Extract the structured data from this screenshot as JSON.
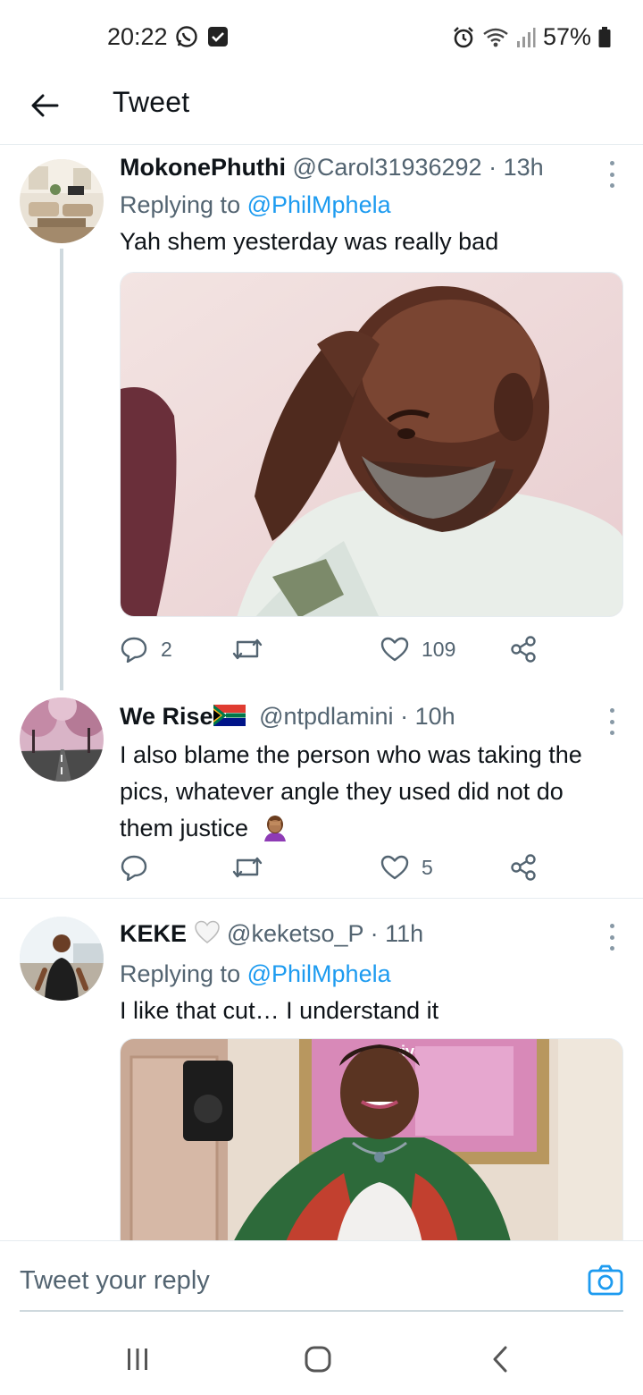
{
  "status_bar": {
    "time": "20:22",
    "battery": "57%"
  },
  "header": {
    "title": "Tweet"
  },
  "tweets": [
    {
      "name": "MokonePhuthi",
      "handle": "@Carol31936292",
      "separator": "·",
      "time": "13h",
      "replying_label": "Replying to",
      "replying_to": "@PhilMphela",
      "text": "Yah shem yesterday was really bad",
      "stats": {
        "replies": "2",
        "retweets": "",
        "likes": "109"
      }
    },
    {
      "name": "We Rise",
      "handle": "@ntpdlamini",
      "separator": "·",
      "time": "10h",
      "text": "I also blame the person who was taking the pics, whatever angle they used did not do them justice",
      "stats": {
        "replies": "",
        "retweets": "",
        "likes": "5"
      }
    },
    {
      "name": "KEKE",
      "handle": "@keketso_P",
      "separator": "·",
      "time": "11h",
      "replying_label": "Replying to",
      "replying_to": "@PhilMphela",
      "text": "I like that cut… I understand it",
      "media_caption": "ewives"
    }
  ],
  "composer": {
    "placeholder": "Tweet your reply"
  },
  "colors": {
    "accent": "#1d9bf0",
    "text": "#0f1419",
    "muted": "#536471"
  },
  "icons": [
    "whatsapp-icon",
    "check-box-icon",
    "alarm-icon",
    "wifi-icon",
    "signal-icon",
    "battery-icon",
    "back-arrow-icon",
    "more-icon",
    "reply-icon",
    "retweet-icon",
    "like-icon",
    "share-icon",
    "camera-icon",
    "recents-icon",
    "home-icon",
    "back-nav-icon",
    "sa-flag-icon",
    "white-heart-icon",
    "facepalm-emoji-icon"
  ]
}
